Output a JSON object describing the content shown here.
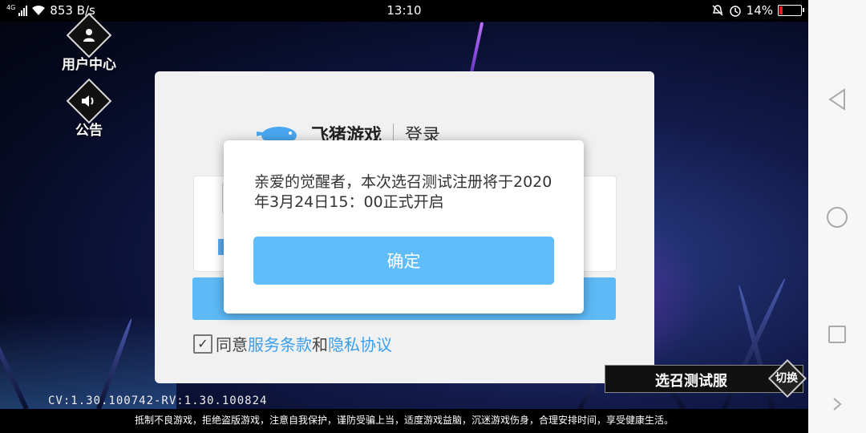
{
  "status_bar": {
    "network": "4G",
    "speed": "853 B/s",
    "time": "13:10",
    "battery": "14%"
  },
  "side_menu": {
    "user_center": "用户中心",
    "announcement": "公告"
  },
  "login_panel": {
    "brand": "飞猪游戏",
    "title": "登录",
    "agree_prefix": "同意",
    "terms_link": "服务条款",
    "and_text": "和",
    "privacy_link": "隐私协议"
  },
  "dialog": {
    "message": "亲爱的觉醒者，本次选召测试注册将于2020年3月24日15：00正式开启",
    "confirm": "确定"
  },
  "server": {
    "name": "选召测试服",
    "switch": "切换"
  },
  "version": "CV:1.30.100742-RV:1.30.100824",
  "notice": "抵制不良游戏，拒绝盗版游戏，注意自我保护，谨防受骗上当，适度游戏益脑，沉迷游戏伤身，合理安排时间，享受健康生活。",
  "colors": {
    "accent": "#5ebdfa",
    "link": "#3a9ef0"
  }
}
